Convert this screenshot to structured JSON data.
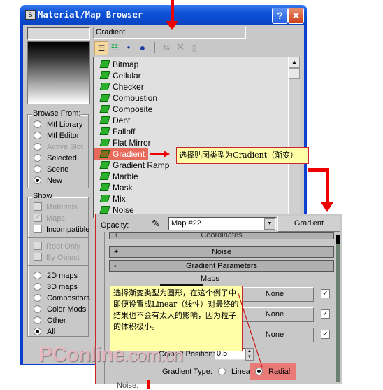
{
  "window": {
    "title": "Material/Map Browser",
    "help_label": "?",
    "close_label": "✕"
  },
  "map_name_field": "Gradient",
  "toolbar": {
    "icons": [
      "view-list-icon",
      "view-list-icons-icon",
      "small-icons-icon",
      "large-icons-icon",
      "update-scene-icon",
      "delete-icon",
      "clear-library-icon"
    ]
  },
  "browse_from": {
    "label": "Browse From:",
    "options": [
      {
        "label": "Mtl Library",
        "selected": false,
        "enabled": true
      },
      {
        "label": "Mtl Editor",
        "selected": false,
        "enabled": true
      },
      {
        "label": "Active Slot",
        "selected": false,
        "enabled": false
      },
      {
        "label": "Selected",
        "selected": false,
        "enabled": true
      },
      {
        "label": "Scene",
        "selected": false,
        "enabled": true
      },
      {
        "label": "New",
        "selected": true,
        "enabled": true
      }
    ]
  },
  "show": {
    "label": "Show",
    "checkboxes": [
      {
        "label": "Materials",
        "checked": false,
        "enabled": false
      },
      {
        "label": "Maps",
        "checked": true,
        "enabled": false
      },
      {
        "label": "Incompatible",
        "checked": false,
        "enabled": true
      }
    ],
    "extra_checkboxes": [
      {
        "label": "Root Only",
        "checked": false,
        "enabled": false
      },
      {
        "label": "By Object",
        "checked": false,
        "enabled": false
      }
    ],
    "map_types": [
      {
        "label": "2D maps",
        "selected": false
      },
      {
        "label": "3D maps",
        "selected": false
      },
      {
        "label": "Compositors",
        "selected": false
      },
      {
        "label": "Color Mods",
        "selected": false
      },
      {
        "label": "Other",
        "selected": false
      },
      {
        "label": "All",
        "selected": true
      }
    ]
  },
  "map_list": {
    "items": [
      "Bitmap",
      "Cellular",
      "Checker",
      "Combustion",
      "Composite",
      "Dent",
      "Falloff",
      "Flat Mirror",
      "Gradient",
      "Gradient Ramp",
      "Marble",
      "Mask",
      "Mix",
      "Noise"
    ],
    "selected": "Gradient"
  },
  "annotations": {
    "callout1": "选择贴图类型为Gradient（渐变）",
    "callout2": "选择渐变类型为圆形，在这个例子中即便设置成Linear（线性）对最终的结果也不会有太大的影响，因为粒子的体积极小。"
  },
  "param_panel": {
    "opacity_label": "Opacity:",
    "map_dropdown": "Map #22",
    "map_type_button": "Gradient",
    "rollouts": [
      {
        "sign": "+",
        "label": "Coordinates"
      },
      {
        "sign": "+",
        "label": "Noise"
      },
      {
        "sign": "-",
        "label": "Gradient Parameters"
      }
    ],
    "maps_label": "Maps",
    "map_slots": [
      {
        "label": "None",
        "checked": true
      },
      {
        "label": "None",
        "checked": true
      },
      {
        "label": "None",
        "checked": true
      }
    ],
    "color2_position_label": "Color 2 Position:",
    "color2_position_value": "0.5",
    "gradient_type_label": "Gradient Type:",
    "gradient_types": [
      {
        "label": "Linear",
        "selected": false
      },
      {
        "label": "Radial",
        "selected": true
      }
    ],
    "noise_label": "Noise:"
  },
  "watermark": {
    "main": "PConline",
    "sub": ".com.cn"
  },
  "colors": {
    "titlebar": "#0c52d8",
    "dialog_bg": "#c8c8c8",
    "selection": "#e86a5a",
    "callout_bg": "#ffffa8",
    "arrow": "#ee0000"
  }
}
